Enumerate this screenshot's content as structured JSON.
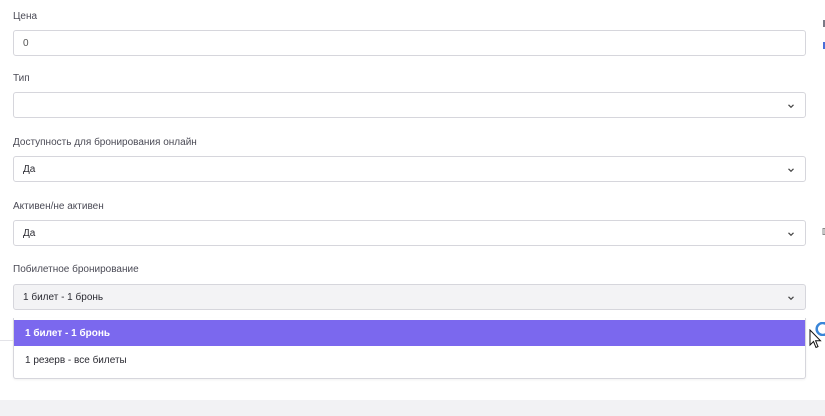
{
  "form": {
    "price": {
      "label": "Цена",
      "value": "0"
    },
    "type": {
      "label": "Тип",
      "value": ""
    },
    "online": {
      "label": "Доступность для бронирования онлайн",
      "value": "Да"
    },
    "active": {
      "label": "Активен/не активен",
      "value": "Да"
    },
    "ticket_booking": {
      "label": "Побилетное бронирование",
      "value": "1 билет - 1 бронь",
      "options": [
        "1 билет - 1 бронь",
        "1 резерв - все билеты"
      ]
    }
  },
  "colors": {
    "accent": "#7b68ee",
    "border": "#d6d6dc",
    "footer_bg": "#f2f2f4"
  },
  "icons": {
    "select_arrow": "chevron-down-icon",
    "pointer": "mouse-cursor-icon"
  }
}
